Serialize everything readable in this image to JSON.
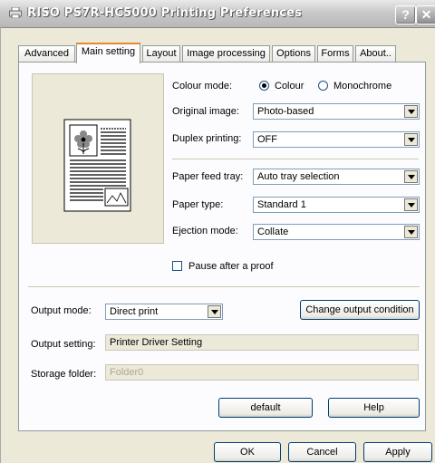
{
  "window": {
    "title": "RISO PS7R-HC5000 Printing Preferences",
    "help_glyph": "?",
    "close_glyph": "✕"
  },
  "tabs": [
    {
      "label": "Advanced"
    },
    {
      "label": "Main setting"
    },
    {
      "label": "Layout"
    },
    {
      "label": "Image processing"
    },
    {
      "label": "Options"
    },
    {
      "label": "Forms"
    },
    {
      "label": "About.."
    }
  ],
  "active_tab": "Main setting",
  "main": {
    "colour_mode": {
      "label": "Colour mode:",
      "options": [
        "Colour",
        "Monochrome"
      ],
      "selected": "Colour"
    },
    "original_image": {
      "label": "Original image:",
      "value": "Photo-based"
    },
    "duplex_printing": {
      "label": "Duplex printing:",
      "value": "OFF"
    },
    "paper_feed_tray": {
      "label": "Paper feed tray:",
      "value": "Auto tray selection"
    },
    "paper_type": {
      "label": "Paper type:",
      "value": "Standard 1"
    },
    "ejection_mode": {
      "label": "Ejection mode:",
      "value": "Collate"
    },
    "pause_after_proof": {
      "label": "Pause after a proof",
      "checked": false
    }
  },
  "output": {
    "mode_label": "Output mode:",
    "mode_value": "Direct print",
    "change_button": "Change output condition",
    "setting_label": "Output setting:",
    "setting_value": "Printer Driver Setting",
    "folder_label": "Storage folder:",
    "folder_value": "Folder0"
  },
  "panel_buttons": {
    "default": "default",
    "help": "Help"
  },
  "dialog_buttons": {
    "ok": "OK",
    "cancel": "Cancel",
    "apply": "Apply"
  }
}
